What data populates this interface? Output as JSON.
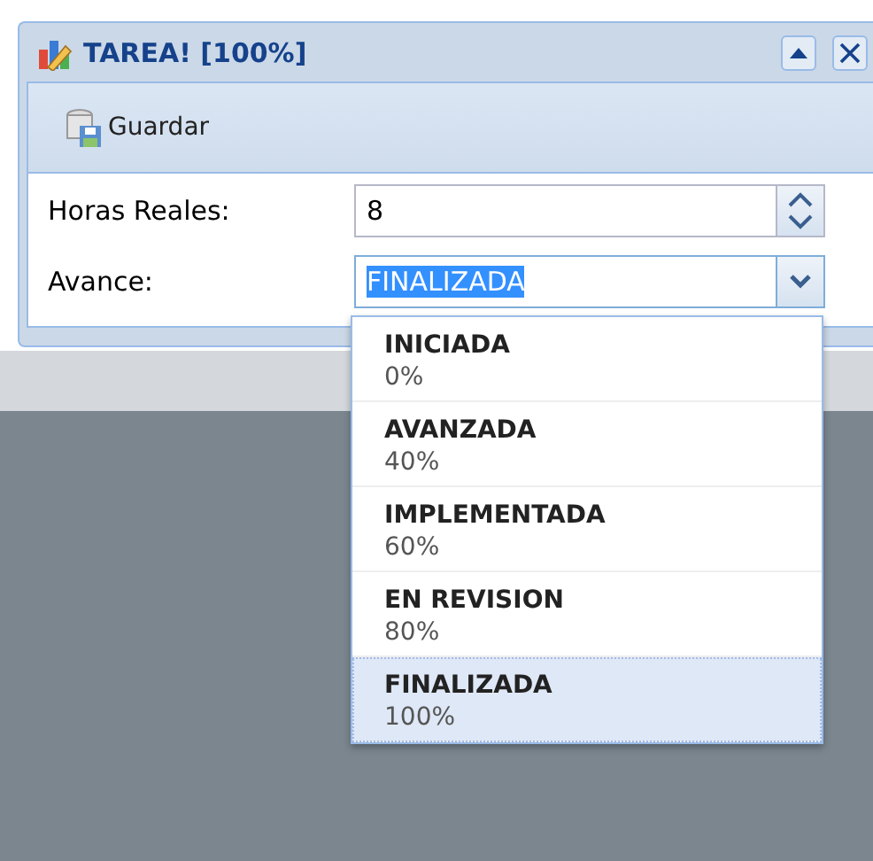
{
  "window": {
    "title": "TAREA! [100%]"
  },
  "toolbar": {
    "buttons": [
      "Guardar"
    ]
  },
  "form": {
    "hours": {
      "label": "Horas Reales:",
      "value": "8"
    },
    "progress": {
      "label": "Avance:",
      "value": "FINALIZADA",
      "expanded": true
    }
  },
  "dropdown": [
    {
      "name": "INICIADA",
      "percent": "0%",
      "selected": false
    },
    {
      "name": "AVANZADA",
      "percent": "40%",
      "selected": false
    },
    {
      "name": "IMPLEMENTADA",
      "percent": "60%",
      "selected": false
    },
    {
      "name": "EN REVISION",
      "percent": "80%",
      "selected": false
    },
    {
      "name": "FINALIZADA",
      "percent": "100%",
      "selected": true
    }
  ]
}
